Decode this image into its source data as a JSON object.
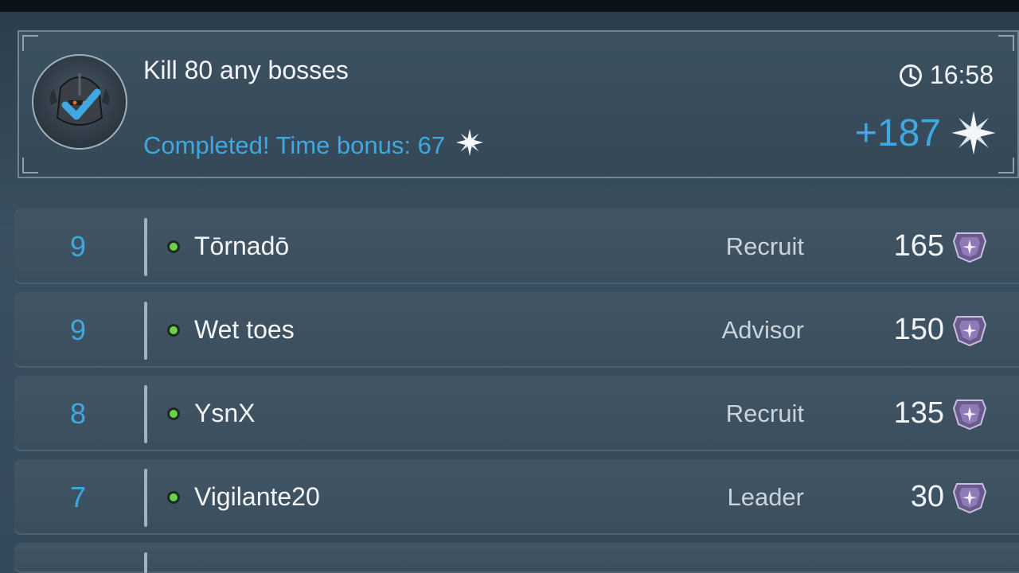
{
  "quest": {
    "title": "Kill 80 any bosses",
    "status": "Completed! Time bonus: 67",
    "timer": "16:58",
    "reward": "+187",
    "icons": {
      "avatar": "knight-helmet-icon",
      "check": "checkmark-icon",
      "timer": "clock-icon",
      "reward": "star-icon"
    }
  },
  "colors": {
    "accent": "#3fa8e0",
    "online": "#6bd04a"
  },
  "members": [
    {
      "rank": "9",
      "name": "Tōrnadō",
      "role": "Recruit",
      "score": "165"
    },
    {
      "rank": "9",
      "name": "Wet toes",
      "role": "Advisor",
      "score": "150"
    },
    {
      "rank": "8",
      "name": "YsnX",
      "role": "Recruit",
      "score": "135"
    },
    {
      "rank": "7",
      "name": "Vigilante20",
      "role": "Leader",
      "score": "30"
    }
  ]
}
